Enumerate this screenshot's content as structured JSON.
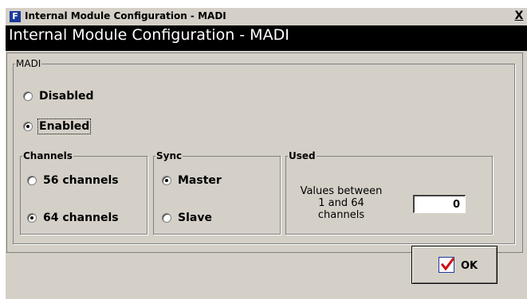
{
  "window": {
    "icon_letter": "F",
    "title": "Internal Module Configuration - MADI",
    "close_glyph": "X"
  },
  "banner": {
    "title": "Internal Module Configuration - MADI"
  },
  "madi": {
    "legend": "MADI",
    "options": [
      {
        "label": "Disabled",
        "selected": false
      },
      {
        "label": "Enabled",
        "selected": true
      }
    ]
  },
  "channels": {
    "legend": "Channels",
    "options": [
      {
        "label": "56 channels",
        "selected": false
      },
      {
        "label": "64 channels",
        "selected": true
      }
    ]
  },
  "sync": {
    "legend": "Sync",
    "options": [
      {
        "label": "Master",
        "selected": true
      },
      {
        "label": "Slave",
        "selected": false
      }
    ]
  },
  "used": {
    "legend": "Used",
    "hint_lines": [
      "Values between",
      "1 and 64",
      "channels"
    ],
    "value": "0"
  },
  "ok_button": {
    "label": "OK",
    "icon": "checkmark-icon"
  }
}
